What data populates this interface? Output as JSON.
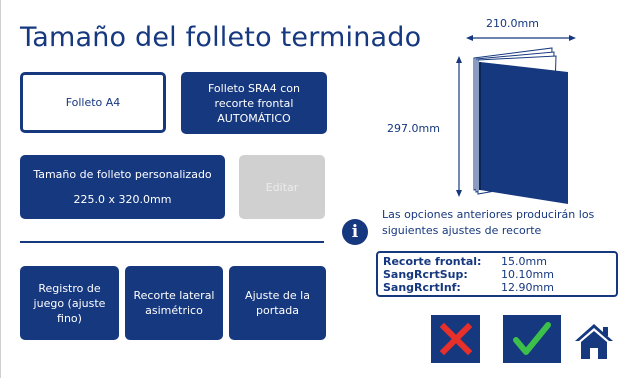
{
  "title": "Tamaño del folleto terminado",
  "buttons": {
    "a4": "Folleto A4",
    "sra4": "Folleto SRA4 con recorte frontal AUTOMÁTICO",
    "custom_title": "Tamaño de folleto personalizado",
    "custom_size": "225.0 x 320.0mm",
    "edit": "Editar",
    "registro": "Registro de juego (ajuste fino)",
    "recorte_lateral": "Recorte lateral asimétrico",
    "ajuste_portada": "Ajuste de la portada"
  },
  "preview": {
    "width_label": "210.0mm",
    "height_label": "297.0mm"
  },
  "info": {
    "text": "Las opciones anteriores producirán los siguientes ajustes de recorte",
    "rows": [
      {
        "label": "Recorte frontal:",
        "value": "15.0mm"
      },
      {
        "label": "SangRcrtSup:",
        "value": "10.10mm"
      },
      {
        "label": "SangRcrtInf:",
        "value": "12.90mm"
      }
    ]
  },
  "colors": {
    "primary": "#16387f",
    "cancel_icon": "#e8302a",
    "confirm_icon": "#3cc04a",
    "disabled": "#d0d0d0"
  },
  "icons": [
    "info-icon",
    "close-icon",
    "checkmark-icon",
    "home-icon",
    "booklet-icon"
  ]
}
